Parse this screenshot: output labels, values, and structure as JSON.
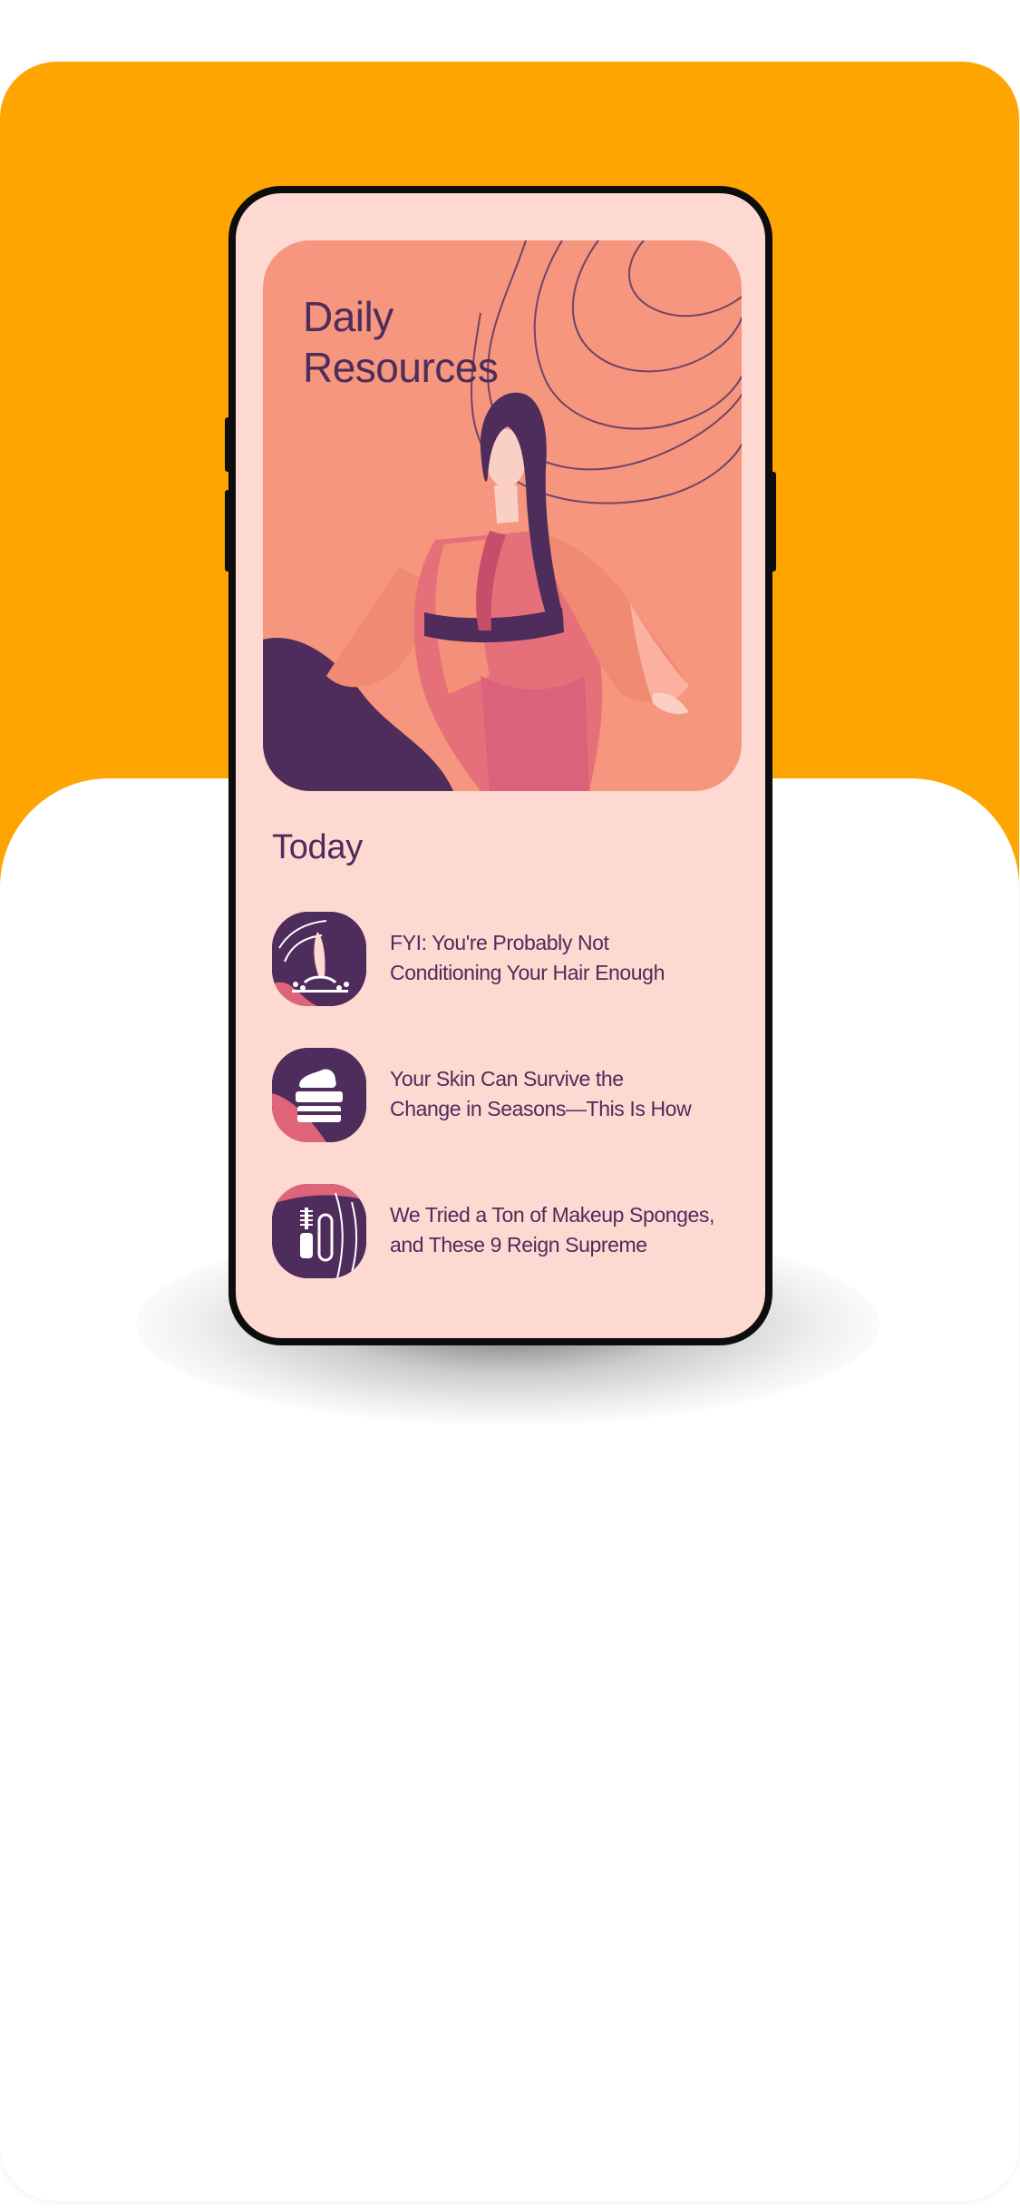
{
  "hero": {
    "title_line1": "Daily",
    "title_line2": "Resources",
    "illustration": "woman-in-kimono-illustration"
  },
  "section": {
    "title": "Today"
  },
  "articles": [
    {
      "title_line1": "FYI: You're Probably Not",
      "title_line2": "Conditioning Your Hair Enough",
      "icon": "hair-strand-icon"
    },
    {
      "title_line1": "Your Skin Can Survive the",
      "title_line2": "Change in Seasons—This Is How",
      "icon": "cream-jar-icon"
    },
    {
      "title_line1": "We Tried a Ton of Makeup Sponges,",
      "title_line2": "and These 9 Reign Supreme",
      "icon": "mascara-icon"
    }
  ],
  "colors": {
    "accent_orange": "#FFA502",
    "screen_background": "#FDD9D1",
    "hero_background": "#F6967E",
    "ink_purple": "#4E2C5B",
    "accent_pink": "#E06479"
  }
}
